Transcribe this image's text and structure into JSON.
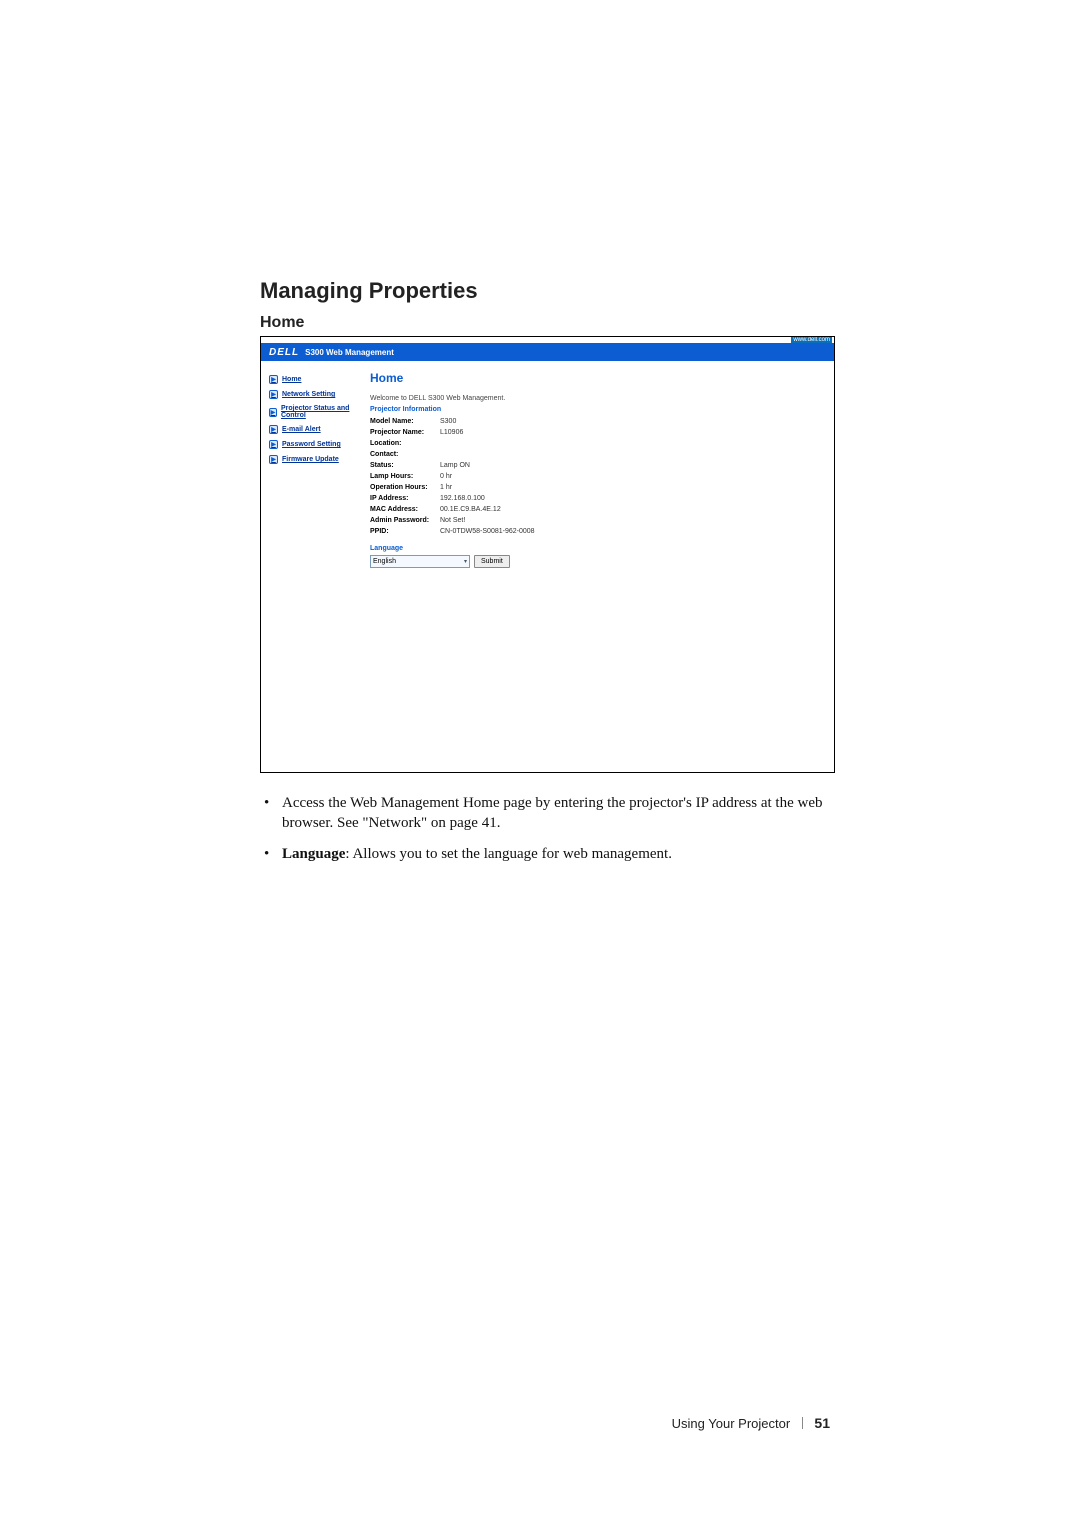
{
  "headings": {
    "section": "Managing Properties",
    "subsection": "Home"
  },
  "topbar": {
    "url_hint": "www.dell.com",
    "logo": "DELL",
    "title": "S300 Web Management"
  },
  "sidebar": {
    "items": [
      {
        "label": "Home"
      },
      {
        "label": "Network Setting"
      },
      {
        "label": "Projector Status and Control"
      },
      {
        "label": "E-mail Alert"
      },
      {
        "label": "Password Setting"
      },
      {
        "label": "Firmware Update"
      }
    ]
  },
  "panel": {
    "title": "Home",
    "welcome": "Welcome to DELL S300 Web Management.",
    "info_heading": "Projector Information",
    "rows": [
      {
        "key": "Model Name:",
        "val": "S300"
      },
      {
        "key": "Projector Name:",
        "val": "L10906"
      },
      {
        "key": "Location:",
        "val": ""
      },
      {
        "key": "Contact:",
        "val": ""
      },
      {
        "key": "Status:",
        "val": "Lamp ON"
      },
      {
        "key": "Lamp Hours:",
        "val": "0 hr"
      },
      {
        "key": "Operation Hours:",
        "val": "1 hr"
      },
      {
        "key": "IP Address:",
        "val": "192.168.0.100"
      },
      {
        "key": "MAC Address:",
        "val": "00.1E.C9.BA.4E.12"
      },
      {
        "key": "Admin Password:",
        "val": "Not Set!"
      },
      {
        "key": "PPID:",
        "val": "CN-0TDW58-S0081-962-0008"
      }
    ],
    "language_heading": "Language",
    "language_selected": "English",
    "submit_label": "Submit"
  },
  "body_text": {
    "bullet1": "Access the Web Management Home page by entering the projector's IP address at the web browser. See \"Network\" on page 41.",
    "bullet2_prefix": "Language",
    "bullet2_rest": ": Allows you to set the language for web management."
  },
  "footer": {
    "text": "Using Your Projector",
    "page": "51"
  }
}
